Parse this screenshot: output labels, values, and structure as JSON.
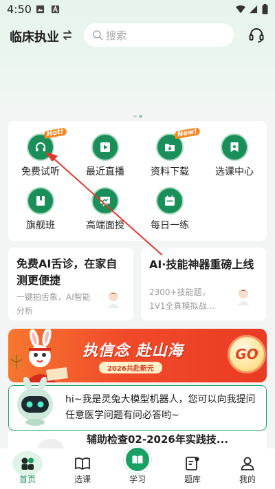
{
  "status_bar": {
    "time": "4:50"
  },
  "header": {
    "exam_title": "临床执业",
    "search_placeholder": "搜索"
  },
  "carousel": {
    "pages": 2,
    "active": 2
  },
  "grid": [
    {
      "label": "免费试听",
      "icon": "headphones-icon",
      "badge": "Hot!"
    },
    {
      "label": "最近直播",
      "icon": "play-icon",
      "badge": ""
    },
    {
      "label": "资料下载",
      "icon": "download-icon",
      "badge": "New!"
    },
    {
      "label": "选课中心",
      "icon": "bookmark-star-icon",
      "badge": ""
    },
    {
      "label": "旗舰班",
      "icon": "book-flag-icon",
      "badge": ""
    },
    {
      "label": "高端面授",
      "icon": "presentation-icon",
      "badge": ""
    },
    {
      "label": "每日一练",
      "icon": "calendar-icon",
      "badge": ""
    }
  ],
  "promos": [
    {
      "title": "免费AI舌诊，在家自测更便捷",
      "subtitle": "一键拍舌象，AI智能分析"
    },
    {
      "title": "AI·技能神器重磅上线",
      "subtitle": "2300+技能题，1V1全真模拟战..."
    }
  ],
  "banner": {
    "slogan": "执信念 赴山海",
    "pill": "2026共赴新元",
    "cta": "GO"
  },
  "assistant": {
    "message": "hi~我是灵兔大模型机器人，您可以向我提问任意医学问题有问必答哟~"
  },
  "list_peek": {
    "title": "辅助检查02-2026年实践技..."
  },
  "tabs": [
    {
      "label": "首页",
      "icon": "home-icon",
      "active": true
    },
    {
      "label": "选课",
      "icon": "open-book-icon",
      "active": false
    },
    {
      "label": "学习",
      "icon": "study-book-icon",
      "active": false
    },
    {
      "label": "题库",
      "icon": "question-bank-icon",
      "active": false
    },
    {
      "label": "我的",
      "icon": "user-icon",
      "active": false
    }
  ],
  "colors": {
    "brand_green": "#18a065",
    "accent_orange": "#f14a2a",
    "annotation_red": "#e0372f"
  }
}
